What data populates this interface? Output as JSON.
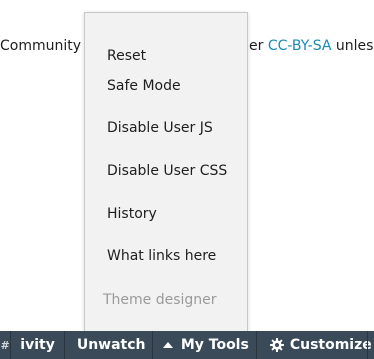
{
  "background": {
    "text_left": "Community",
    "text_right_prefix": "er ",
    "link": "CC-BY-SA",
    "text_right_suffix": " unles"
  },
  "menu": {
    "items": [
      {
        "label": "Reset"
      },
      {
        "label": "Safe Mode"
      },
      {
        "label": "Disable User JS"
      },
      {
        "label": "Disable User CSS"
      },
      {
        "label": "History"
      },
      {
        "label": "What links here"
      },
      {
        "label": "Theme designer",
        "disabled": true
      }
    ]
  },
  "toolbar": {
    "cut_glyph": "#",
    "activity_label": "ivity",
    "unwatch_label": "Unwatch",
    "mytools_label": "My Tools",
    "customize_label": "Customize"
  },
  "colors": {
    "toolbar_bg": "#3a4a59",
    "menu_bg": "#f2f2f2",
    "link": "#1a8ab5",
    "disabled_text": "#9a9a9a"
  },
  "icons": {
    "mytools": "triangle-up-icon",
    "customize": "gear-icon"
  }
}
